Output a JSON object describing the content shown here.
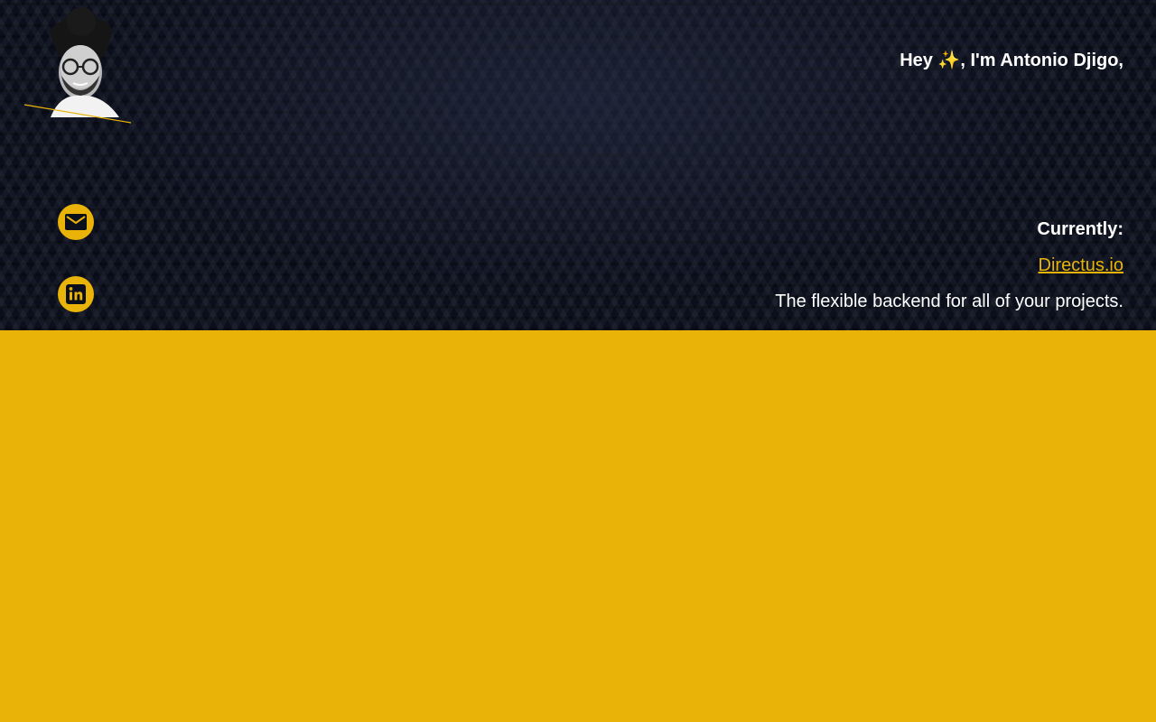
{
  "header": {
    "greeting": "Hey ✨, I'm Antonio Djigo,",
    "avatar_icon": "portrait-avatar"
  },
  "social": {
    "email_icon": "envelope-icon",
    "linkedin_icon": "linkedin-icon"
  },
  "current": {
    "label": "Currently:",
    "company": "Directus.io",
    "tagline": "The flexible backend for all of your projects."
  },
  "colors": {
    "accent": "#e9b308",
    "hero_bg": "#0b0f1c",
    "text": "#ffffff"
  }
}
